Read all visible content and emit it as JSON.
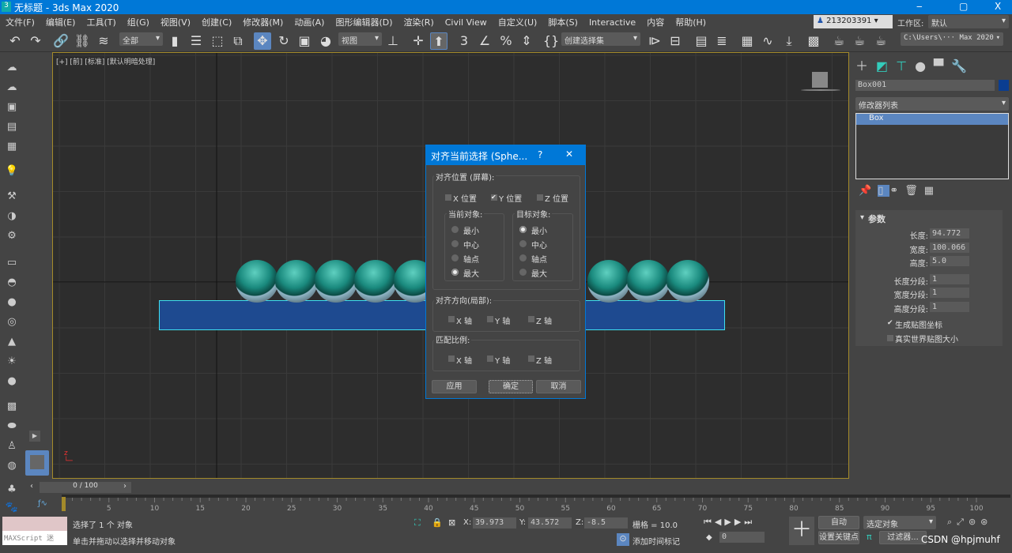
{
  "window": {
    "title": "无标题 - 3ds Max 2020",
    "min": "‒",
    "max": "▢",
    "close": "X"
  },
  "menu": [
    "文件(F)",
    "编辑(E)",
    "工具(T)",
    "组(G)",
    "视图(V)",
    "创建(C)",
    "修改器(M)",
    "动画(A)",
    "图形编辑器(D)",
    "渲染(R)",
    "Civil View",
    "自定义(U)",
    "脚本(S)",
    "Interactive",
    "内容",
    "帮助(H)"
  ],
  "account": {
    "user": "213203391",
    "workspace_label": "工作区:",
    "workspace": "默认"
  },
  "toolbar": {
    "filter": "全部",
    "ref_coord": "视图",
    "selection_set": "创建选择集",
    "project_path": "C:\\Users\\··· Max 2020"
  },
  "viewport": {
    "label": "[+] [前] [标准] [默认明暗处理]",
    "box_color": "#1e4a90",
    "sphere_color": "#1a8a7e"
  },
  "dialog": {
    "title": "对齐当前选择 (Sphe...",
    "help": "?",
    "close": "✕",
    "pos_group": "对齐位置 (屏幕):",
    "x_pos": "X 位置",
    "y_pos": "Y 位置",
    "z_pos": "Z 位置",
    "x_checked": false,
    "y_checked": true,
    "z_checked": false,
    "current_label": "当前对象:",
    "target_label": "目标对象:",
    "options": [
      "最小",
      "中心",
      "轴点",
      "最大"
    ],
    "current_selected": "最大",
    "target_selected": "最小",
    "orient_group": "对齐方向(局部):",
    "scale_group": "匹配比例:",
    "x_axis": "X 轴",
    "y_axis": "Y 轴",
    "z_axis": "Z 轴",
    "apply": "应用",
    "ok": "确定",
    "cancel": "取消"
  },
  "panel": {
    "object_name": "Box001",
    "object_color": "#0a3d91",
    "modifier_list": "修改器列表",
    "stack": [
      "Box"
    ],
    "rollout": "参数",
    "params": [
      {
        "label": "长度:",
        "value": "94.772"
      },
      {
        "label": "宽度:",
        "value": "100.066"
      },
      {
        "label": "高度:",
        "value": "5.0"
      },
      {
        "label": "长度分段:",
        "value": "1"
      },
      {
        "label": "宽度分段:",
        "value": "1"
      },
      {
        "label": "高度分段:",
        "value": "1"
      }
    ],
    "gen_uv": "生成贴图坐标",
    "gen_uv_checked": true,
    "real_world": "真实世界贴图大小",
    "real_world_checked": false
  },
  "timeline": {
    "frame": "0 / 100",
    "ticks": [
      "5",
      "10",
      "15",
      "20",
      "25",
      "30",
      "35",
      "40",
      "45",
      "50",
      "55",
      "60",
      "65",
      "70",
      "75",
      "80",
      "85",
      "90",
      "95",
      "100"
    ]
  },
  "status": {
    "maxscript": "MAXScript 迷",
    "selected": "选择了 1 个 对象",
    "hint": "单击并拖动以选择并移动对象",
    "x_label": "X:",
    "x": "39.973",
    "y_label": "Y:",
    "y": "43.572",
    "z_label": "Z:",
    "z": "-8.5",
    "grid": "栅格 = 10.0",
    "add_time_tag": "添加时间标记",
    "auto": "自动",
    "set_key": "设置关键点",
    "key_target": "选定对象",
    "filters": "过滤器...",
    "frame_value": "0",
    "watermark": "CSDN @hpjmuhf"
  }
}
